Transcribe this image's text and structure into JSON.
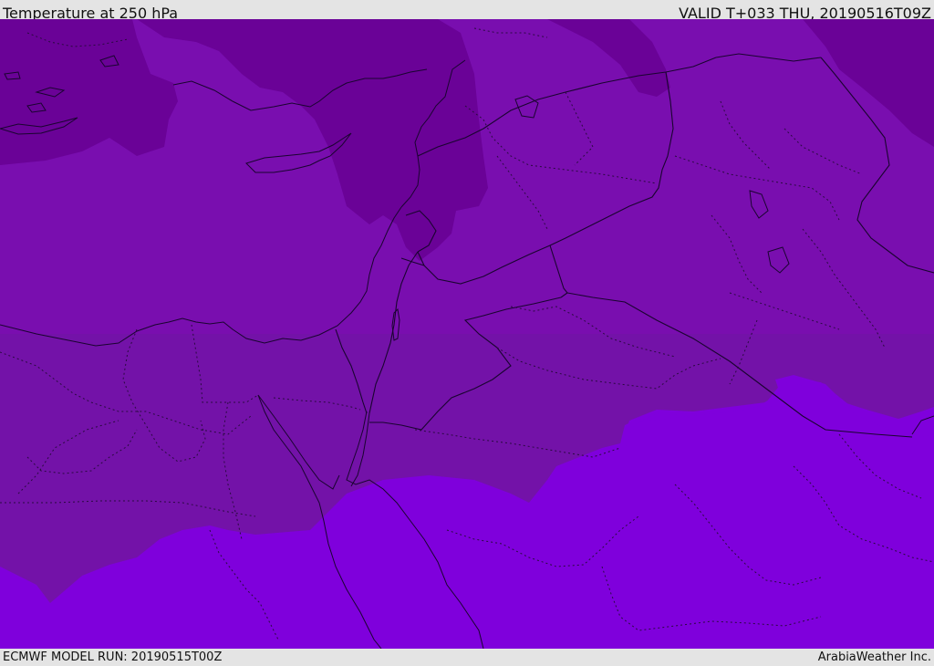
{
  "header": {
    "title": "Temperature at 250 hPa",
    "valid": "VALID T+033 THU, 20190516T09Z"
  },
  "footer": {
    "model_run": "ECMWF MODEL RUN: 20190515T00Z",
    "credit": "ArabiaWeather Inc."
  },
  "map": {
    "colors": {
      "cold_band": "#6a0297",
      "mid_band": "#790eaf",
      "mid_band_alt": "#7312a8",
      "warm_band": "#7f00dc",
      "boundary_line": "#1a0430"
    }
  }
}
